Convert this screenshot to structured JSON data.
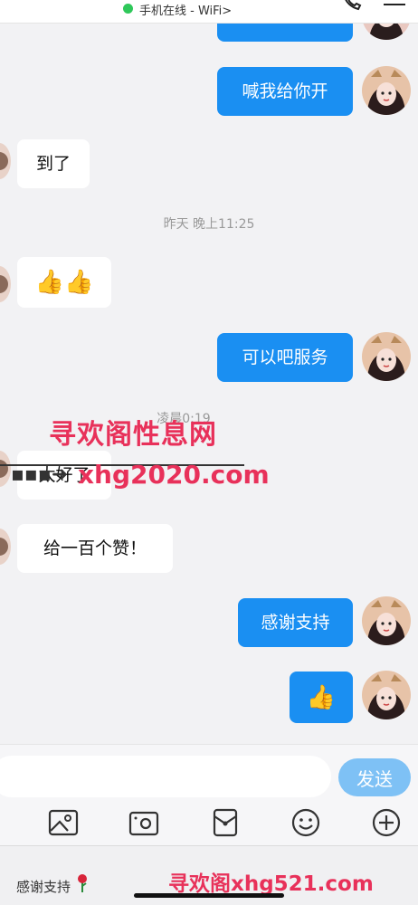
{
  "status": {
    "text": "手机在线 - WiFi",
    "chevron": ">"
  },
  "messages": [
    {
      "side": "me",
      "text": "喊我给你开"
    },
    {
      "side": "them",
      "text": "到了"
    },
    {
      "side": "them",
      "text": "👍👍"
    },
    {
      "side": "me",
      "text": "可以吧服务"
    },
    {
      "side": "them",
      "text": "太好了"
    },
    {
      "side": "them",
      "text": "给一百个赞！"
    },
    {
      "side": "me",
      "text": "感谢支持"
    },
    {
      "side": "me",
      "text": "👍"
    }
  ],
  "timestamps": [
    "昨天 晚上11:25",
    "凌晨0:19"
  ],
  "watermark": {
    "line1": "寻欢阁性息网",
    "line2": "xhg2020.com",
    "footer": "寻欢阁xhg521.com"
  },
  "input": {
    "placeholder": "",
    "send_label": "发送"
  },
  "toolbar": {
    "icons": [
      "picture-icon",
      "camera-icon",
      "red-packet-icon",
      "emoji-icon",
      "plus-icon"
    ]
  },
  "bottom": {
    "quick_reply": "感谢支持"
  },
  "colors": {
    "accent": "#1a8ff2",
    "send_disabled": "#7ec1f5",
    "watermark": "#e8315a",
    "online": "#2fc85a"
  }
}
